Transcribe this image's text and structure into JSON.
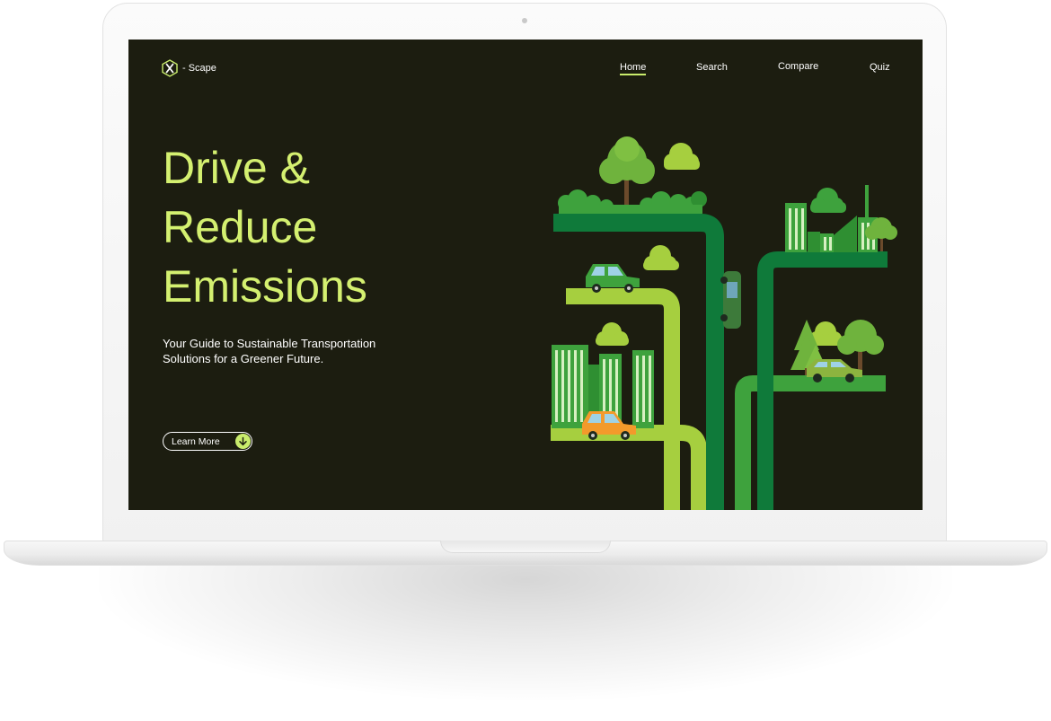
{
  "logo": {
    "text": "- Scape",
    "icon": "x-hexagon-icon"
  },
  "nav": [
    {
      "label": "Home",
      "active": true
    },
    {
      "label": "Search",
      "active": false
    },
    {
      "label": "Compare",
      "active": false
    },
    {
      "label": "Quiz",
      "active": false
    }
  ],
  "hero": {
    "title_lines": [
      "Drive &",
      "Reduce",
      "Emissions"
    ],
    "subtitle": "Your Guide to Sustainable Transportation Solutions for a Greener Future.",
    "cta_label": "Learn More",
    "cta_icon": "arrow-down-icon"
  },
  "colors": {
    "background": "#1c1d10",
    "accent": "#c9ec6c",
    "title": "#d4f070",
    "dark_green": "#0f7a3a",
    "mid_green": "#3ea23d",
    "light_green": "#a6cf3f"
  }
}
